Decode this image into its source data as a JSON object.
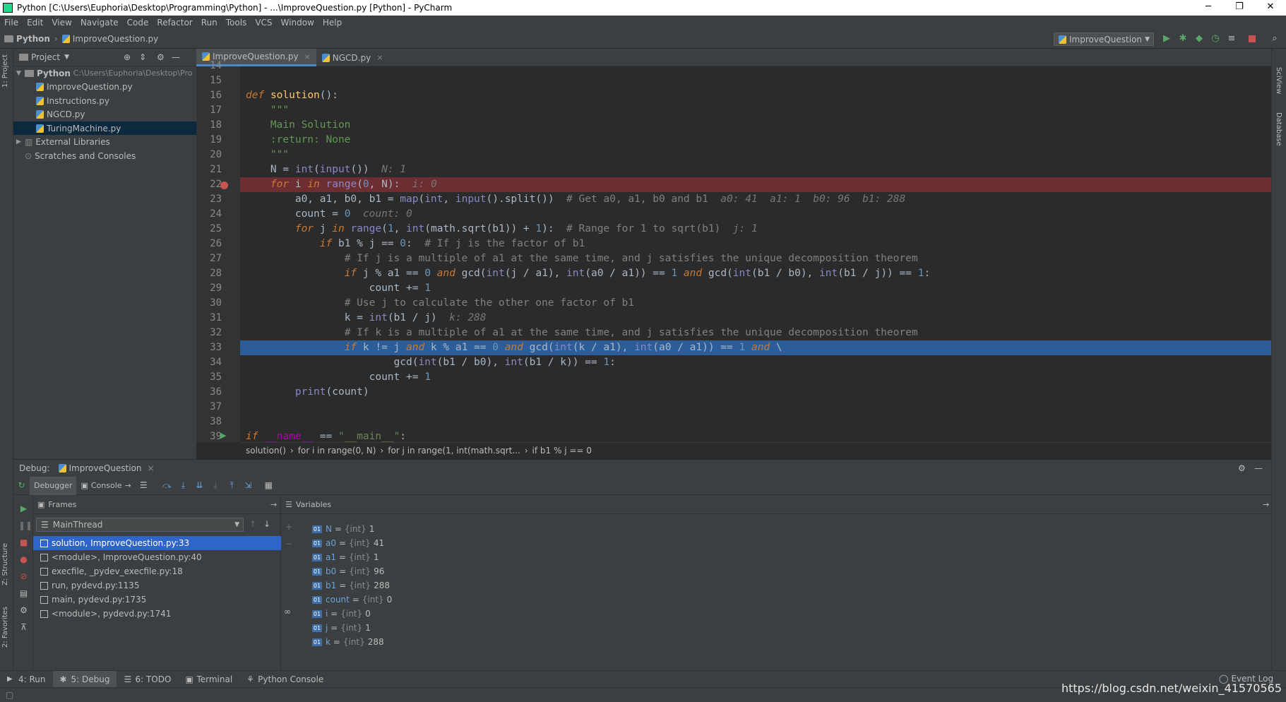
{
  "window": {
    "title": "Python [C:\\Users\\Euphoria\\Desktop\\Programming\\Python] - ...\\ImproveQuestion.py [Python] - PyCharm",
    "minimize": "─",
    "restore": "❐",
    "close": "✕"
  },
  "menu": [
    "File",
    "Edit",
    "View",
    "Navigate",
    "Code",
    "Refactor",
    "Run",
    "Tools",
    "VCS",
    "Window",
    "Help"
  ],
  "nav": {
    "project": "Python",
    "file": "ImproveQuestion.py",
    "run_config": "ImproveQuestion"
  },
  "left_stripe": {
    "project": "1: Project",
    "structure": "Z: Structure",
    "favorites": "2: Favorites"
  },
  "right_stripe": {
    "sciview": "SciView",
    "database": "Database"
  },
  "project": {
    "header": "Project",
    "root": "Python",
    "root_path": "C:\\Users\\Euphoria\\Desktop\\Pro",
    "files": [
      "ImproveQuestion.py",
      "Instructions.py",
      "NGCD.py",
      "TuringMachine.py"
    ],
    "external": "External Libraries",
    "scratches": "Scratches and Consoles"
  },
  "editor_tabs": [
    {
      "label": "ImproveQuestion.py",
      "close": "×"
    },
    {
      "label": "NGCD.py",
      "close": "×"
    }
  ],
  "line_numbers": [
    "14",
    "15",
    "16",
    "17",
    "18",
    "19",
    "20",
    "21",
    "22",
    "23",
    "24",
    "25",
    "26",
    "27",
    "28",
    "29",
    "30",
    "31",
    "32",
    "33",
    "34",
    "35",
    "36",
    "37",
    "38",
    "39"
  ],
  "code": {
    "l16a": "def",
    "l16b": "solution",
    "l16c": "():",
    "l17": "    \"\"\"",
    "l18": "    Main Solution",
    "l19": "    :return: None",
    "l20": "    \"\"\"",
    "l21a": "    N = ",
    "l21b": "int",
    "l21c": "(",
    "l21d": "input",
    "l21e": "())",
    "l21h": "N: 1",
    "l22a": "for",
    "l22b": " i ",
    "l22c": "in",
    "l22d": " ",
    "l22e": "range",
    "l22f": "(",
    "l22g": "0",
    "l22h": ", N):",
    "l22i": "i: 0",
    "l23a": "        a0, a1, b0, b1 = ",
    "l23b": "map",
    "l23c": "(",
    "l23d": "int",
    "l23e": ", ",
    "l23f": "input",
    "l23g": "().split())  ",
    "l23h": "# Get a0, a1, b0 and b1",
    "l23i": "a0: 41  a1: 1  b0: 96  b1: 288",
    "l24a": "        count = ",
    "l24b": "0",
    "l24h": "count: 0",
    "l25a": "for",
    "l25b": " j ",
    "l25c": "in",
    "l25d": " ",
    "l25e": "range",
    "l25f": "(",
    "l25g": "1",
    "l25k": ", ",
    "l25l": "int",
    "l25m": "(math.sqrt(b1)) + ",
    "l25n": "1",
    "l25o": "):  ",
    "l25p": "# Range for 1 to sqrt(b1)",
    "l25h": "j: 1",
    "l26a": "if",
    "l26b": " b1 % j == ",
    "l26c": "0",
    "l26d": ":  ",
    "l26e": "# If j is the factor of b1",
    "l27": "# If j is a multiple of a1 at the same time, and j satisfies the unique decomposition theorem",
    "l28a": "if",
    "l28b": " j % a1 == ",
    "l28c": "0",
    "l28d": " ",
    "l28e": "and",
    "l28f": " gcd(",
    "l28g": "int",
    "l28h": "(j / a1), ",
    "l28i": "int",
    "l28j": "(a0 / a1)) == ",
    "l28k": "1",
    "l28l": " ",
    "l28m": "and",
    "l28n": " gcd(",
    "l28o": "int",
    "l28p": "(b1 / b0), ",
    "l28q": "int",
    "l28r": "(b1 / j)) == ",
    "l28s": "1",
    "l28t": ":",
    "l29a": "count += ",
    "l29b": "1",
    "l30": "# Use j to calculate the other one factor of b1",
    "l31a": "k = ",
    "l31b": "int",
    "l31c": "(b1 / j)",
    "l31h": "k: 288",
    "l32": "# If k is a multiple of a1 at the same time, and j satisfies the unique decomposition theorem",
    "l33a": "if",
    "l33b": " k != j ",
    "l33c": "and",
    "l33d": " k % a1 == ",
    "l33e": "0",
    "l33f": " ",
    "l33g": "and",
    "l33i": " gcd(",
    "l33j": "int",
    "l33k": "(k / a1), ",
    "l33l": "int",
    "l33m": "(a0 / a1)) == ",
    "l33n": "1",
    "l33o": " ",
    "l33p": "and",
    "l33q": " \\",
    "l34a": "gcd(",
    "l34b": "int",
    "l34c": "(b1 / b0), ",
    "l34d": "int",
    "l34e": "(b1 / k)) == ",
    "l34f": "1",
    "l34g": ":",
    "l35a": "count += ",
    "l35b": "1",
    "l36a": "print",
    "l36b": "(count)",
    "l39a": "if",
    "l39b": " ",
    "l39c": "__name__",
    "l39d": " == ",
    "l39e": "\"__main__\"",
    "l39f": ":"
  },
  "breadcrumbs": [
    "solution()",
    "›",
    "for i in range(0, N)",
    "›",
    "for j in range(1, int(math.sqrt...",
    "›",
    "if b1 % j == 0"
  ],
  "debug": {
    "label": "Debug:",
    "config": "ImproveQuestion",
    "close": "×",
    "tabs": [
      "Debugger",
      "Console"
    ],
    "frames_label": "Frames",
    "variables_label": "Variables",
    "thread": "MainThread"
  },
  "frames": [
    "solution, ImproveQuestion.py:33",
    "<module>, ImproveQuestion.py:40",
    "execfile, _pydev_execfile.py:18",
    "run, pydevd.py:1135",
    "main, pydevd.py:1735",
    "<module>, pydevd.py:1741"
  ],
  "variables": [
    {
      "name": "N",
      "type": "{int}",
      "value": "1"
    },
    {
      "name": "a0",
      "type": "{int}",
      "value": "41"
    },
    {
      "name": "a1",
      "type": "{int}",
      "value": "1"
    },
    {
      "name": "b0",
      "type": "{int}",
      "value": "96"
    },
    {
      "name": "b1",
      "type": "{int}",
      "value": "288"
    },
    {
      "name": "count",
      "type": "{int}",
      "value": "0"
    },
    {
      "name": "i",
      "type": "{int}",
      "value": "0"
    },
    {
      "name": "j",
      "type": "{int}",
      "value": "1"
    },
    {
      "name": "k",
      "type": "{int}",
      "value": "288"
    }
  ],
  "bottom_tabs": [
    "4: Run",
    "5: Debug",
    "6: TODO",
    "Terminal",
    "Python Console"
  ],
  "event_log": "Event Log",
  "watermark": "https://blog.csdn.net/weixin_41570565",
  "var_badge": "01",
  "var_eq": "="
}
